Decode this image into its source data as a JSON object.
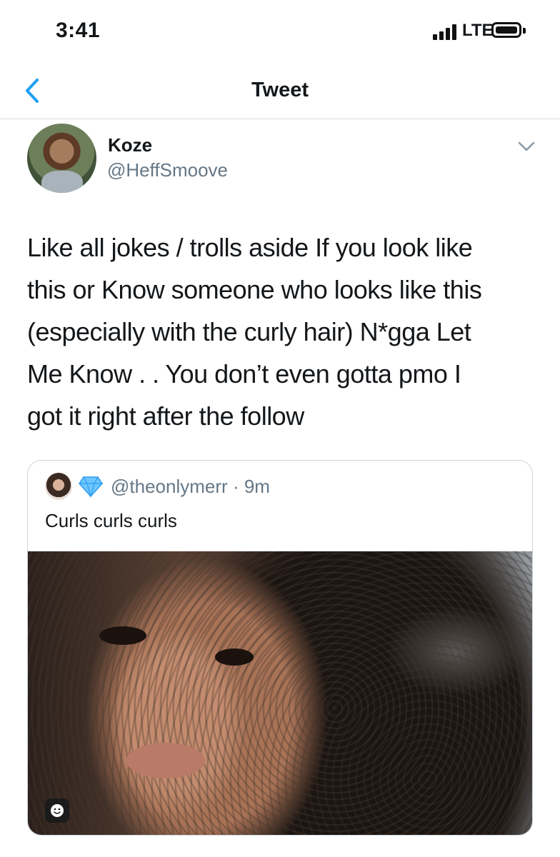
{
  "status_bar": {
    "time": "3:41",
    "network": "LTE"
  },
  "nav": {
    "title": "Tweet"
  },
  "tweet": {
    "author_name": "Koze",
    "author_handle": "@HeffSmoove",
    "text_lines": [
      "Like all jokes / trolls aside If you look like",
      "this or Know someone who looks like this",
      "(especially with the curly hair) N*gga Let",
      "Me Know . . You don’t even gotta pmo I",
      "got it right after the follow"
    ]
  },
  "quoted_tweet": {
    "handle": "@theonlymerr",
    "separator": "·",
    "time_ago": "9m",
    "text": "Curls curls curls"
  },
  "icons": {
    "back": "chevron-left-icon",
    "more": "chevron-down-icon",
    "verified_badge": "diamond-icon",
    "media_overlay": "smiley-icon"
  },
  "colors": {
    "accent": "#1da1f2",
    "secondary_text": "#657786",
    "divider": "#d9dee2"
  }
}
